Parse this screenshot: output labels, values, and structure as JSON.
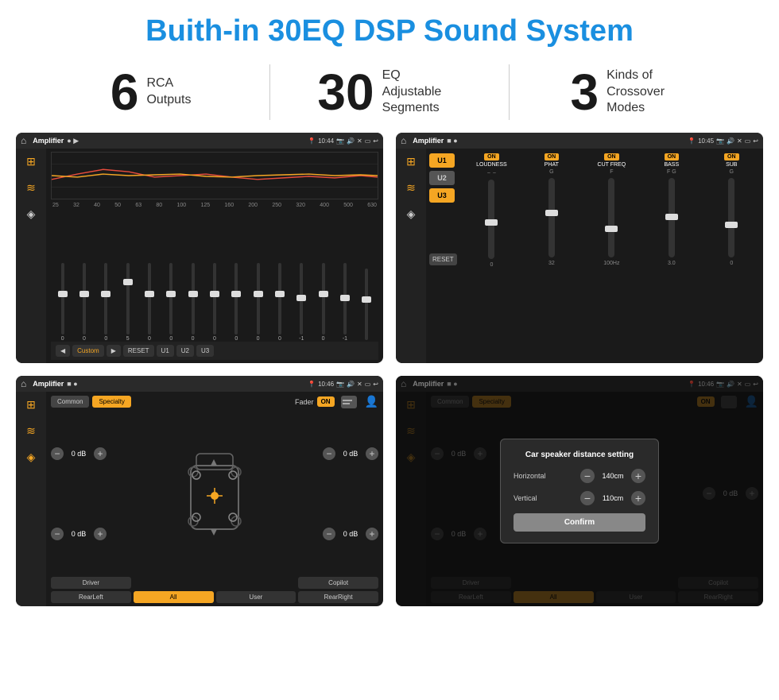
{
  "page": {
    "title": "Buith-in 30EQ DSP Sound System"
  },
  "stats": [
    {
      "number": "6",
      "label": "RCA\nOutputs"
    },
    {
      "number": "30",
      "label": "EQ Adjustable\nSegments"
    },
    {
      "number": "3",
      "label": "Kinds of\nCrossover Modes"
    }
  ],
  "screens": {
    "eq": {
      "app_name": "Amplifier",
      "time": "10:44",
      "freqs": [
        "25",
        "32",
        "40",
        "50",
        "63",
        "80",
        "100",
        "125",
        "160",
        "200",
        "250",
        "320",
        "400",
        "500",
        "630"
      ],
      "vals": [
        "0",
        "0",
        "0",
        "5",
        "0",
        "0",
        "0",
        "0",
        "0",
        "0",
        "0",
        "-1",
        "0",
        "-1",
        ""
      ],
      "buttons": [
        "Custom",
        "RESET",
        "U1",
        "U2",
        "U3"
      ]
    },
    "crossover": {
      "app_name": "Amplifier",
      "time": "10:45",
      "u_buttons": [
        "U1",
        "U2",
        "U3"
      ],
      "channels": [
        "LOUDNESS",
        "PHAT",
        "CUT FREQ",
        "BASS",
        "SUB"
      ],
      "reset": "RESET"
    },
    "fader": {
      "app_name": "Amplifier",
      "time": "10:46",
      "tabs": [
        "Common",
        "Specialty"
      ],
      "fader_label": "Fader",
      "on_label": "ON",
      "db_values": [
        "0 dB",
        "0 dB",
        "0 dB",
        "0 dB"
      ],
      "bottom_buttons": [
        "Driver",
        "All",
        "User",
        "RearRight",
        "RearLeft",
        "Copilot"
      ]
    },
    "distance": {
      "app_name": "Amplifier",
      "time": "10:46",
      "tabs": [
        "Common",
        "Specialty"
      ],
      "on_label": "ON",
      "dialog": {
        "title": "Car speaker distance setting",
        "horizontal_label": "Horizontal",
        "horizontal_val": "140cm",
        "vertical_label": "Vertical",
        "vertical_val": "110cm",
        "confirm_label": "Confirm"
      },
      "db_values": [
        "0 dB",
        "0 dB"
      ],
      "bottom_buttons": [
        "Driver",
        "Copilot",
        "RearLeft",
        "All",
        "User",
        "RearRight"
      ]
    }
  }
}
